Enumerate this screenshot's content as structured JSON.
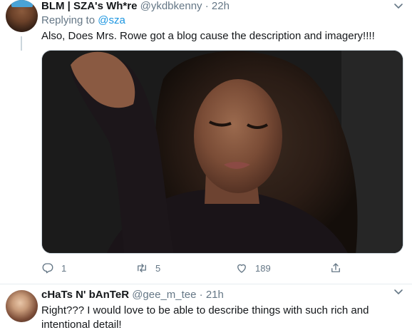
{
  "tweets": [
    {
      "author_name": "BLM | SZA's Wh*re",
      "handle": "@ykdbkenny",
      "separator": "·",
      "time": "22h",
      "replying_prefix": "Replying to ",
      "replying_to": "@sza",
      "text": "Also, Does Mrs. Rowe got a blog cause the description and imagery!!!!",
      "actions": {
        "reply_count": "1",
        "retweet_count": "5",
        "like_count": "189"
      }
    },
    {
      "author_name": "cHaTs N' bAnTeR",
      "handle": "@gee_m_tee",
      "separator": "·",
      "time": "21h",
      "text": "Right??? I would love to be able to describe things with such rich and intentional detail!"
    }
  ],
  "colors": {
    "link": "#1b95e0",
    "secondary_text": "#657786",
    "divider": "#e6ecf0"
  },
  "icons": [
    "chevron-down-icon",
    "reply-icon",
    "retweet-icon",
    "like-icon",
    "share-icon"
  ]
}
